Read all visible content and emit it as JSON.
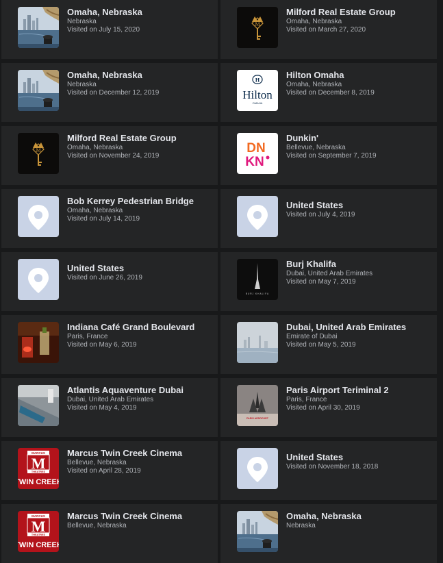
{
  "places": [
    {
      "title": "Omaha, Nebraska",
      "subtitle": "Nebraska",
      "visited": "Visited on July 15, 2020",
      "icon": "omaha-skyline-photo"
    },
    {
      "title": "Milford Real Estate Group",
      "subtitle": "Omaha, Nebraska",
      "visited": "Visited on March 27, 2020",
      "icon": "milford-logo"
    },
    {
      "title": "Omaha, Nebraska",
      "subtitle": "Nebraska",
      "visited": "Visited on December 12, 2019",
      "icon": "omaha-skyline-photo"
    },
    {
      "title": "Hilton Omaha",
      "subtitle": "Omaha, Nebraska",
      "visited": "Visited on December 8, 2019",
      "icon": "hilton-logo"
    },
    {
      "title": "Milford Real Estate Group",
      "subtitle": "Omaha, Nebraska",
      "visited": "Visited on November 24, 2019",
      "icon": "milford-logo"
    },
    {
      "title": "Dunkin'",
      "subtitle": "Bellevue, Nebraska",
      "visited": "Visited on September 7, 2019",
      "icon": "dunkin-logo"
    },
    {
      "title": "Bob Kerrey Pedestrian Bridge",
      "subtitle": "Omaha, Nebraska",
      "visited": "Visited on July 14, 2019",
      "icon": "map-pin-icon"
    },
    {
      "title": "United States",
      "subtitle": "",
      "visited": "Visited on July 4, 2019",
      "icon": "map-pin-icon"
    },
    {
      "title": "United States",
      "subtitle": "",
      "visited": "Visited on June 26, 2019",
      "icon": "map-pin-icon"
    },
    {
      "title": "Burj Khalifa",
      "subtitle": "Dubai, United Arab Emirates",
      "visited": "Visited on May 7, 2019",
      "icon": "burj-khalifa-logo",
      "logo_text": "BURJ KHALIFA"
    },
    {
      "title": "Indiana Café Grand Boulevard",
      "subtitle": "Paris, France",
      "visited": "Visited on May 6, 2019",
      "icon": "cafe-photo"
    },
    {
      "title": "Dubai, United Arab Emirates",
      "subtitle": "Emirate of Dubai",
      "visited": "Visited on May 5, 2019",
      "icon": "dubai-skyline-photo"
    },
    {
      "title": "Atlantis Aquaventure Dubai",
      "subtitle": "Dubai, United Arab Emirates",
      "visited": "Visited on May 4, 2019",
      "icon": "aquaventure-photo"
    },
    {
      "title": "Paris Airport Teriminal 2",
      "subtitle": "Paris, France",
      "visited": "Visited on April 30, 2019",
      "icon": "paris-aeroport-logo"
    },
    {
      "title": "Marcus Twin Creek Cinema",
      "subtitle": "Bellevue, Nebraska",
      "visited": "Visited on April 28, 2019",
      "icon": "marcus-twin-creek-logo"
    },
    {
      "title": "United States",
      "subtitle": "",
      "visited": "Visited on November 18, 2018",
      "icon": "map-pin-icon"
    },
    {
      "title": "Marcus Twin Creek Cinema",
      "subtitle": "Bellevue, Nebraska",
      "visited": "",
      "icon": "marcus-twin-creek-logo"
    },
    {
      "title": "Omaha, Nebraska",
      "subtitle": "Nebraska",
      "visited": "",
      "icon": "omaha-skyline-photo"
    }
  ],
  "logos": {
    "hilton_word": "Hilton",
    "hilton_sub": "OMAHA",
    "dunkin_top": "DN",
    "dunkin_bottom": "KN",
    "paris_aeroport": "PARIS AEROPORT",
    "marcus_small": "MARCUS",
    "marcus_letter": "M",
    "marcus_theatres": "THEATRES",
    "twin_creek": "TWIN CREEK",
    "milford_letter": "M"
  },
  "colors": {
    "page_bg": "#18191a",
    "card_bg": "#242526",
    "title": "#e4e6eb",
    "secondary": "#b0b3b8",
    "pin_bg": "#c9d3e6",
    "dunkin_orange": "#f26a21",
    "dunkin_pink": "#e0197d",
    "marcus_red": "#b3131b",
    "milford_gold": "#c9953a"
  }
}
